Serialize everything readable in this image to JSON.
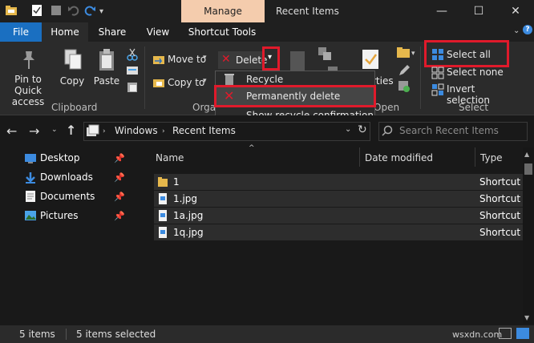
{
  "window": {
    "context_tab": "Manage",
    "title": "Recent Items",
    "minimize": "—",
    "maximize": "☐",
    "close": "✕"
  },
  "ribbon_tabs": [
    "File",
    "Home",
    "Share",
    "View",
    "Shortcut Tools"
  ],
  "clipboard": {
    "pin_label": "Pin to Quick access",
    "copy_label": "Copy",
    "paste_label": "Paste",
    "group_label": "Clipboard"
  },
  "organize": {
    "move_to": "Move to",
    "copy_to": "Copy to",
    "delete": "Delete",
    "group_label": "Organ"
  },
  "open_group": {
    "properties_partial": "rties",
    "group_label": "Open"
  },
  "select": {
    "select_all": "Select all",
    "select_none": "Select none",
    "invert_selection": "Invert selection",
    "group_label": "Select"
  },
  "delete_menu": {
    "items": [
      "Recycle",
      "Permanently delete",
      "Show recycle confirmation"
    ]
  },
  "address": {
    "segments": [
      "Windows",
      "Recent Items"
    ],
    "search_placeholder": "Search Recent Items"
  },
  "nav_pane": {
    "items": [
      "Desktop",
      "Downloads",
      "Documents",
      "Pictures"
    ]
  },
  "file_list": {
    "columns": [
      "Name",
      "Date modified",
      "Type"
    ],
    "rows": [
      {
        "name": "1",
        "type": "Shortcut"
      },
      {
        "name": "1.jpg",
        "type": "Shortcut"
      },
      {
        "name": "1a.jpg",
        "type": "Shortcut"
      },
      {
        "name": "1q.jpg",
        "type": "Shortcut"
      }
    ]
  },
  "status": {
    "count": "5 items",
    "selected": "5 items selected"
  },
  "watermark": "wsxdn.com",
  "colors": {
    "accent": "#1a6fc1",
    "highlight": "#e01a2b",
    "manage_tab": "#f4ccad"
  }
}
